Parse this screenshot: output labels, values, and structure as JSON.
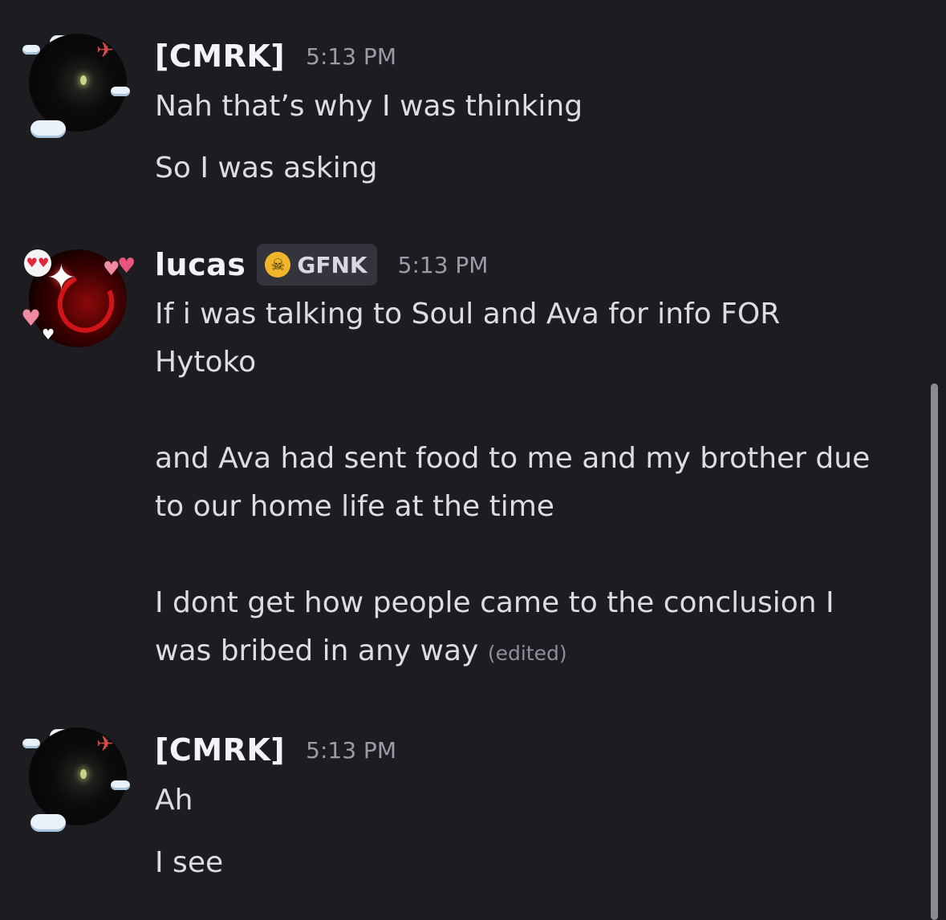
{
  "messages": [
    {
      "username": "[CMRK]",
      "time": "5:13 PM",
      "avatar_icon": "cloud-decorated-avatar",
      "lines": [
        "Nah that’s why I was thinking",
        "So I was asking"
      ]
    },
    {
      "username": "lucas",
      "tag": {
        "icon": "skull-icon",
        "label": "GFNK"
      },
      "time": "5:13 PM",
      "avatar_icon": "heart-decorated-avatar",
      "paragraphs": [
        [
          "If i was talking to Soul and Ava for info FOR",
          "Hytoko"
        ],
        [
          "and Ava had sent food to me and my brother due",
          "to our home life at the time"
        ],
        [
          "I dont get how people came to the conclusion I",
          "was bribed in any way"
        ]
      ],
      "edited_label": "(edited)"
    },
    {
      "username": "[CMRK]",
      "time": "5:13 PM",
      "avatar_icon": "cloud-decorated-avatar",
      "lines": [
        "Ah",
        "I see"
      ]
    }
  ],
  "colors": {
    "background": "#1c1c21",
    "username": "#f2f3f5",
    "message_text": "#dcdde2",
    "timestamp": "#9a9ca6",
    "tag_background": "#34343c",
    "tag_icon": "#f0b52a"
  }
}
